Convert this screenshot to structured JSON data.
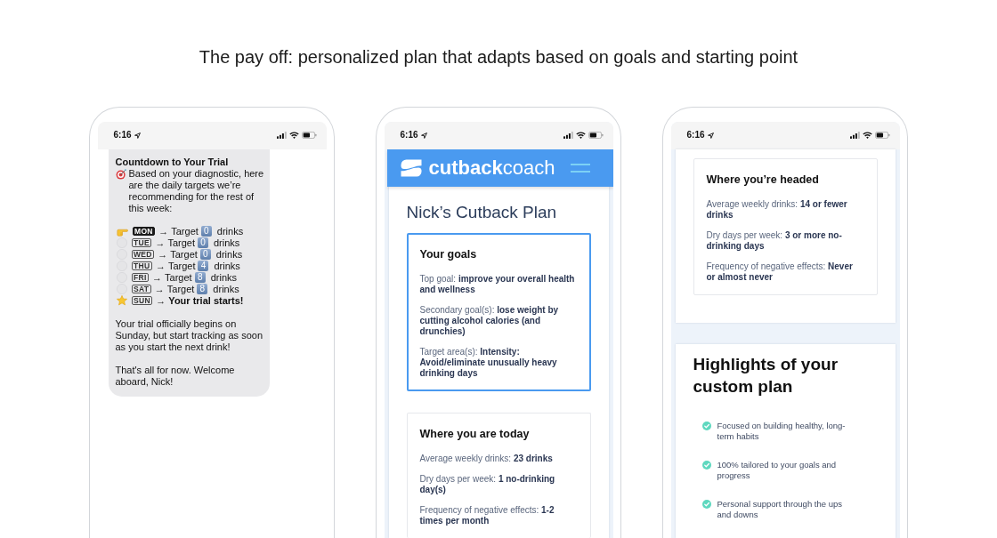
{
  "heading": "The pay off: personalized plan that adapts based on goals and starting point",
  "phones": [
    {
      "kind": "messages",
      "status_bar": {
        "time": "6:16"
      },
      "message": {
        "title": "Countdown to Your Trial",
        "intro": "Based on your diagnostic, here are the daily targets we’re recommending for the rest of this week:",
        "days": [
          {
            "kind": "today",
            "day": "MON",
            "arrow": "→",
            "text": "Target",
            "count": "0",
            "unit": "drinks"
          },
          {
            "kind": "upcoming",
            "day": "TUE",
            "arrow": "→",
            "text": "Target",
            "count": "0",
            "unit": "drinks"
          },
          {
            "kind": "upcoming",
            "day": "WED",
            "arrow": "→",
            "text": "Target",
            "count": "0",
            "unit": "drinks"
          },
          {
            "kind": "upcoming",
            "day": "THU",
            "arrow": "→",
            "text": "Target",
            "count": "4",
            "unit": "drinks"
          },
          {
            "kind": "upcoming",
            "day": "FRI",
            "arrow": "→",
            "text": "Target",
            "count": "8",
            "unit": "drinks"
          },
          {
            "kind": "upcoming",
            "day": "SAT",
            "arrow": "→",
            "text": "Target",
            "count": "8",
            "unit": "drinks"
          },
          {
            "kind": "start",
            "day": "SUN",
            "arrow": "→",
            "text": "Your trial starts!"
          }
        ],
        "paragraphs": [
          "Your trial officially begins on Sunday, but start tracking as soon as you start the next drink!",
          "That's all for now. Welcome aboard, Nick!"
        ]
      }
    },
    {
      "kind": "plan",
      "status_bar": {
        "time": "6:16"
      },
      "header": {
        "logo": "**cutback**coach"
      },
      "panels": [
        {
          "kind": "plan",
          "title": "Nick’s Cutback Plan",
          "cards": [
            {
              "title": "Your goals",
              "highlighted": true,
              "items": [
                "Top goal: **improve your overall health and wellness**",
                "Secondary goal(s): **lose weight by cutting alcohol calories (and drunchies)**",
                "Target area(s): **Intensity: Avoid/eliminate unusually heavy drinking days**"
              ]
            },
            {
              "title": "Where you are today",
              "highlighted": false,
              "items": [
                "Average weekly drinks: **23 drinks**",
                "Dry days per week: **1 no-drinking day(s)**",
                "Frequency of negative effects: **1-2 times per month**"
              ]
            }
          ]
        }
      ]
    },
    {
      "kind": "plan",
      "status_bar": {
        "time": "6:16"
      },
      "panels": [
        {
          "kind": "plan",
          "cards": [
            {
              "title": "Where you’re headed",
              "highlighted": false,
              "items": [
                "Average weekly drinks: **14 or fewer drinks**",
                "Dry days per week: **3 or more no-drinking days**",
                "Frequency of negative effects: **Never or almost never**"
              ]
            }
          ]
        },
        {
          "kind": "highlights",
          "title": "Highlights of your custom plan",
          "items": [
            "Focused on building healthy, long-term habits",
            "100% tailored to your goals and progress",
            "Personal support through the ups and downs"
          ]
        }
      ]
    }
  ]
}
